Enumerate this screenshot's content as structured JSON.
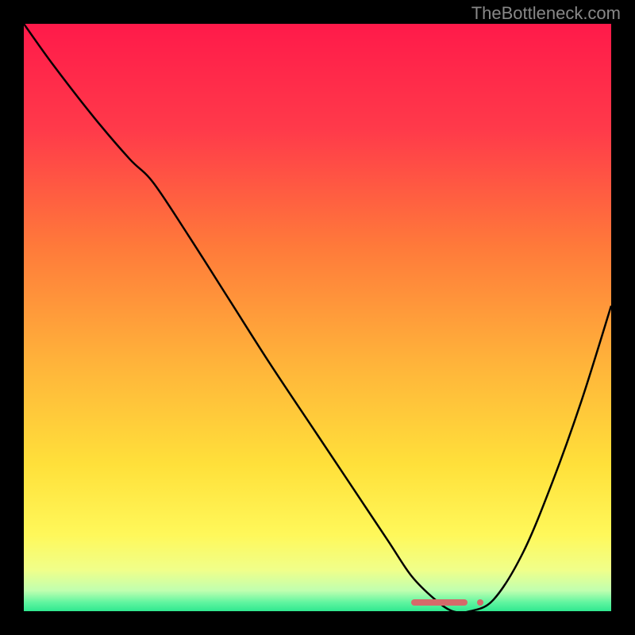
{
  "watermark": "TheBottleneck.com",
  "chart_data": {
    "type": "line",
    "title": "",
    "xlabel": "",
    "ylabel": "",
    "xlim": [
      0,
      100
    ],
    "ylim": [
      0,
      100
    ],
    "gradient_stops": [
      {
        "pos": 0.0,
        "color": "#ff1a4a"
      },
      {
        "pos": 0.18,
        "color": "#ff3a4a"
      },
      {
        "pos": 0.38,
        "color": "#ff7a3a"
      },
      {
        "pos": 0.58,
        "color": "#ffb43a"
      },
      {
        "pos": 0.75,
        "color": "#ffe03a"
      },
      {
        "pos": 0.87,
        "color": "#fff85a"
      },
      {
        "pos": 0.93,
        "color": "#f0ff8a"
      },
      {
        "pos": 0.965,
        "color": "#c0ffb0"
      },
      {
        "pos": 0.985,
        "color": "#60f5a0"
      },
      {
        "pos": 1.0,
        "color": "#30e890"
      }
    ],
    "series": [
      {
        "name": "bottleneck-curve",
        "x": [
          0,
          5,
          12,
          18,
          22,
          28,
          35,
          42,
          50,
          56,
          62,
          66,
          70,
          73,
          76,
          80,
          85,
          90,
          95,
          100
        ],
        "y": [
          100,
          93,
          84,
          77,
          73,
          64,
          53,
          42,
          30,
          21,
          12,
          6,
          2,
          0,
          0,
          2,
          10,
          22,
          36,
          52
        ]
      }
    ],
    "optimal_marker": {
      "x_start": 66,
      "x_end": 78,
      "y": 0
    }
  }
}
